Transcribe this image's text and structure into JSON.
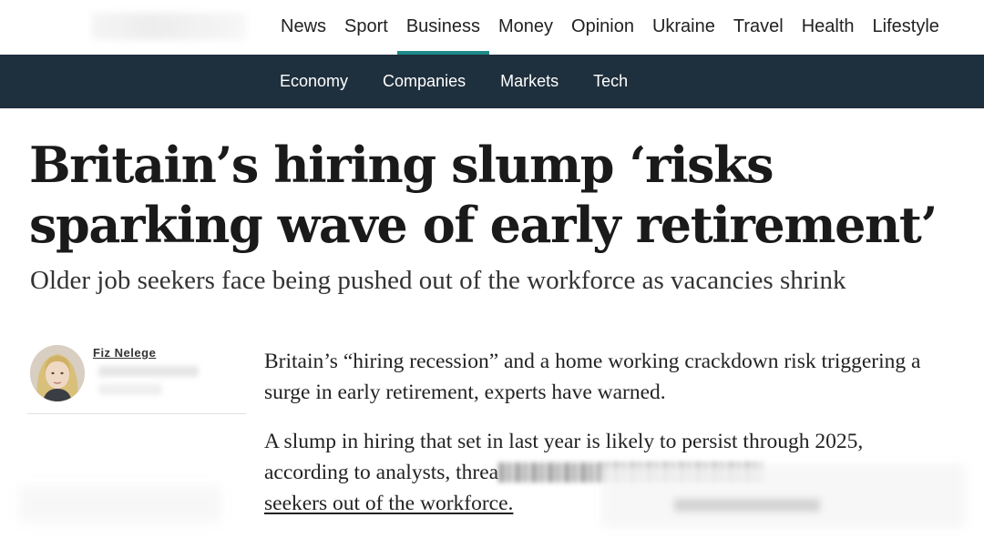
{
  "main_nav": [
    {
      "label": "News"
    },
    {
      "label": "Sport"
    },
    {
      "label": "Business",
      "active": true
    },
    {
      "label": "Money"
    },
    {
      "label": "Opinion"
    },
    {
      "label": "Ukraine"
    },
    {
      "label": "Travel"
    },
    {
      "label": "Health"
    },
    {
      "label": "Lifestyle"
    }
  ],
  "sub_nav": [
    {
      "label": "Economy"
    },
    {
      "label": "Companies"
    },
    {
      "label": "Markets"
    },
    {
      "label": "Tech"
    }
  ],
  "article": {
    "headline": "Britain’s hiring slump ‘risks sparking wave of early retirement’",
    "standfirst": "Older job seekers face being pushed out of the workforce as vacancies shrink",
    "author_name": "Fiz Nelege",
    "paragraph_1": "Britain’s “hiring recession” and a home working crackdown risk triggering a surge in early retirement, experts have warned.",
    "paragraph_2_start": "A slump in hiring that set in last year is likely to persist through 2025, according to analysts, threa",
    "paragraph_2_link": "seekers out of the workforce."
  },
  "colors": {
    "accent": "#1f8a8a",
    "subnav_bg": "#1e2f3d"
  }
}
